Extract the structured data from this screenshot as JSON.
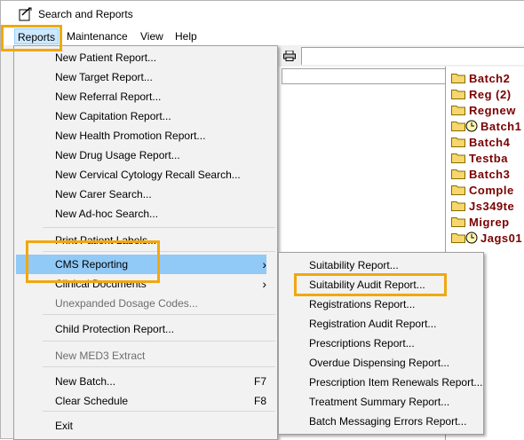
{
  "window": {
    "title": "Search and Reports"
  },
  "menubar": {
    "items": [
      "Reports",
      "Maintenance",
      "View",
      "Help"
    ]
  },
  "reports_menu": {
    "items": [
      {
        "label": "New Patient Report...",
        "accel": "",
        "disabled": false,
        "submenu": false
      },
      {
        "label": "New Target Report...",
        "accel": "",
        "disabled": false,
        "submenu": false
      },
      {
        "label": "New Referral Report...",
        "accel": "",
        "disabled": false,
        "submenu": false
      },
      {
        "label": "New Capitation Report...",
        "accel": "",
        "disabled": false,
        "submenu": false
      },
      {
        "label": "New Health Promotion Report...",
        "accel": "",
        "disabled": false,
        "submenu": false
      },
      {
        "label": "New Drug Usage Report...",
        "accel": "",
        "disabled": false,
        "submenu": false
      },
      {
        "label": "New Cervical Cytology Recall Search...",
        "accel": "",
        "disabled": false,
        "submenu": false
      },
      {
        "label": "New Carer Search...",
        "accel": "",
        "disabled": false,
        "submenu": false
      },
      {
        "label": "New Ad-hoc Search...",
        "accel": "",
        "disabled": false,
        "submenu": false
      },
      {
        "label": "Print Patient Labels...",
        "accel": "",
        "disabled": false,
        "submenu": false
      },
      {
        "label": "CMS Reporting",
        "accel": "",
        "disabled": false,
        "submenu": true
      },
      {
        "label": "Clinical Documents",
        "accel": "",
        "disabled": false,
        "submenu": true
      },
      {
        "label": "Unexpanded Dosage Codes...",
        "accel": "",
        "disabled": true,
        "submenu": false
      },
      {
        "label": "Child Protection Report...",
        "accel": "",
        "disabled": false,
        "submenu": false
      },
      {
        "label": "New MED3 Extract",
        "accel": "",
        "disabled": true,
        "submenu": false
      },
      {
        "label": "New Batch...",
        "accel": "F7",
        "disabled": false,
        "submenu": false
      },
      {
        "label": "Clear Schedule",
        "accel": "F8",
        "disabled": false,
        "submenu": false
      },
      {
        "label": "Exit",
        "accel": "",
        "disabled": false,
        "submenu": false
      }
    ]
  },
  "cms_submenu": {
    "items": [
      "Suitability Report...",
      "Suitability Audit Report...",
      "Registrations Report...",
      "Registration Audit Report...",
      "Prescriptions Report...",
      "Overdue Dispensing Report...",
      "Prescription Item Renewals Report...",
      "Treatment Summary Report...",
      "Batch Messaging Errors Report..."
    ]
  },
  "batches": [
    {
      "label": "Batch2",
      "clock": false
    },
    {
      "label": "Reg (2)",
      "clock": false
    },
    {
      "label": "Regnew",
      "clock": false
    },
    {
      "label": "Batch1",
      "clock": true
    },
    {
      "label": "Batch4",
      "clock": false
    },
    {
      "label": "Testba",
      "clock": false
    },
    {
      "label": "Batch3",
      "clock": false
    },
    {
      "label": "Comple",
      "clock": false
    },
    {
      "label": "Js349te",
      "clock": false
    },
    {
      "label": "Migrep",
      "clock": false
    },
    {
      "label": "Jags01",
      "clock": true
    }
  ],
  "colors": {
    "highlight": "#91c9f7",
    "callout": "#f0a810",
    "batch_text": "#7b0000",
    "folder": "#f5d76e"
  }
}
